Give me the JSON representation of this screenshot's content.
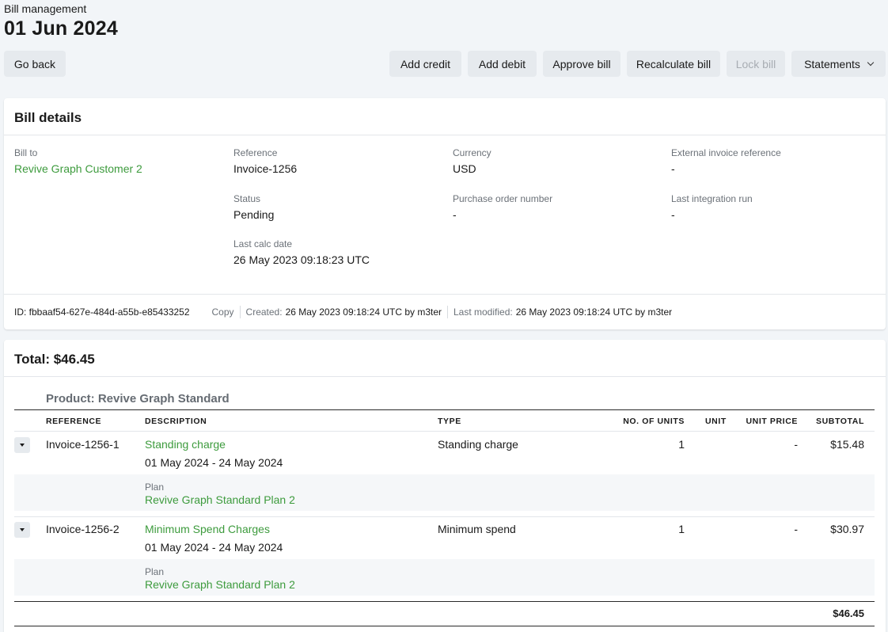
{
  "header": {
    "breadcrumb": "Bill management",
    "title": "01 Jun 2024"
  },
  "toolbar": {
    "go_back": "Go back",
    "add_credit": "Add credit",
    "add_debit": "Add debit",
    "approve_bill": "Approve bill",
    "recalculate_bill": "Recalculate bill",
    "lock_bill": "Lock bill",
    "statements": "Statements"
  },
  "bill_details": {
    "heading": "Bill details",
    "bill_to_label": "Bill to",
    "bill_to_value": "Revive Graph Customer 2",
    "reference_label": "Reference",
    "reference_value": "Invoice-1256",
    "status_label": "Status",
    "status_value": "Pending",
    "last_calc_label": "Last calc date",
    "last_calc_value": "26 May 2023 09:18:23 UTC",
    "currency_label": "Currency",
    "currency_value": "USD",
    "po_label": "Purchase order number",
    "po_value": "-",
    "ext_ref_label": "External invoice reference",
    "ext_ref_value": "-",
    "last_integration_label": "Last integration run",
    "last_integration_value": "-",
    "meta": {
      "id_text": "ID: fbbaaf54-627e-484d-a55b-e85433252",
      "copy": "Copy",
      "created_label": "Created:",
      "created_value": "26 May 2023 09:18:24 UTC by m3ter",
      "modified_label": "Last modified:",
      "modified_value": "26 May 2023 09:18:24 UTC by m3ter"
    }
  },
  "total": {
    "heading": "Total: $46.45",
    "product": "Product: Revive Graph Standard",
    "columns": {
      "reference": "REFERENCE",
      "description": "DESCRIPTION",
      "type": "TYPE",
      "units": "NO. OF UNITS",
      "unit": "UNIT",
      "unit_price": "UNIT PRICE",
      "subtotal": "SUBTOTAL"
    },
    "rows": [
      {
        "reference": "Invoice-1256-1",
        "description": "Standing charge",
        "period": "01 May 2024 - 24 May 2024",
        "type": "Standing charge",
        "units": "1",
        "unit": "",
        "unit_price": "-",
        "subtotal": "$15.48",
        "plan_label": "Plan",
        "plan_value": "Revive Graph Standard Plan 2"
      },
      {
        "reference": "Invoice-1256-2",
        "description": "Minimum Spend Charges",
        "period": "01 May 2024 - 24 May 2024",
        "type": "Minimum spend",
        "units": "1",
        "unit": "",
        "unit_price": "-",
        "subtotal": "$30.97",
        "plan_label": "Plan",
        "plan_value": "Revive Graph Standard Plan 2"
      }
    ],
    "grand_total": "$46.45"
  },
  "colors": {
    "link_green": "#3d9b3d",
    "page_bg": "#f2f5f8",
    "button_bg": "#e6eaee"
  }
}
